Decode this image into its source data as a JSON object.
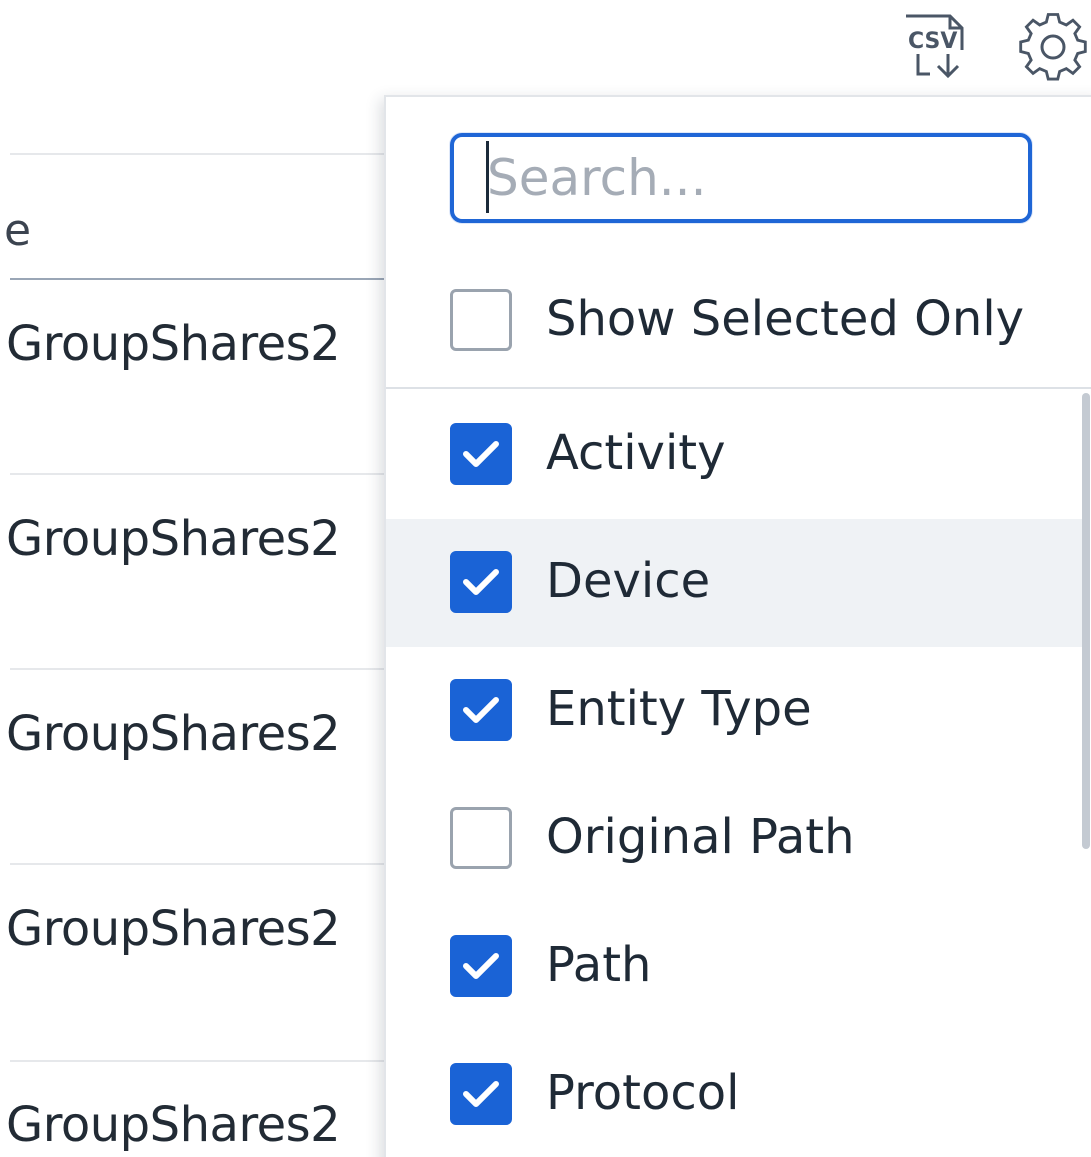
{
  "toolbar": {
    "csv_icon": "csv-download-icon",
    "csv_text": "CSV",
    "settings_icon": "gear-icon"
  },
  "table": {
    "header_fragment": "e",
    "rows": [
      "GroupShares2",
      "GroupShares2",
      "GroupShares2",
      "GroupShares2",
      "GroupShares2"
    ]
  },
  "column_picker": {
    "search": {
      "placeholder": "Search...",
      "value": ""
    },
    "show_selected_only": {
      "label": "Show Selected Only",
      "checked": false
    },
    "columns": [
      {
        "label": "Activity",
        "checked": true
      },
      {
        "label": "Device",
        "checked": true
      },
      {
        "label": "Entity Type",
        "checked": true
      },
      {
        "label": "Original Path",
        "checked": false
      },
      {
        "label": "Path",
        "checked": true
      },
      {
        "label": "Protocol",
        "checked": true
      }
    ]
  },
  "colors": {
    "accent": "#1a63d6",
    "hover_row": "#eff2f5",
    "text": "#1f2a36"
  }
}
